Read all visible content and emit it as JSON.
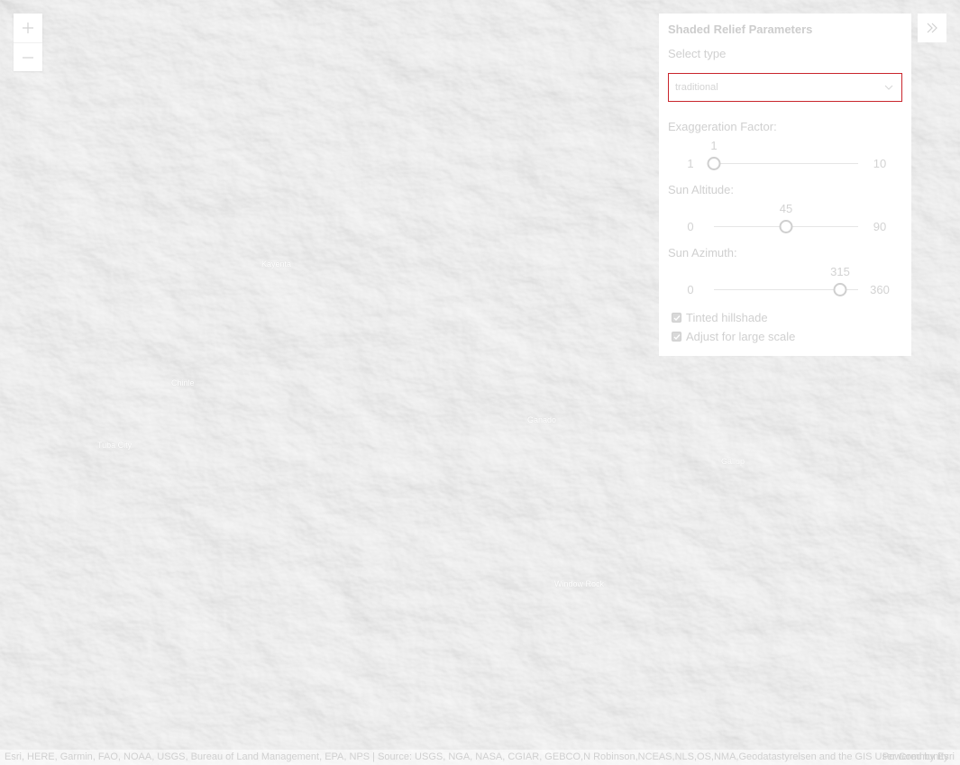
{
  "map": {
    "background_color": "#ececec",
    "labels": [
      {
        "id": "place-1",
        "text": "Kayenta"
      },
      {
        "id": "place-2",
        "text": "Chinle"
      },
      {
        "id": "place-3",
        "text": "Tuba City"
      },
      {
        "id": "place-4",
        "text": "Ganado"
      },
      {
        "id": "place-5",
        "text": "Gallup"
      },
      {
        "id": "place-6",
        "text": "Window Rock"
      }
    ]
  },
  "zoom": {
    "in_icon": "plus-icon",
    "out_icon": "minus-icon"
  },
  "collapse": {
    "icon": "double-chevron-right-icon"
  },
  "panel": {
    "title": "Shaded Relief Parameters",
    "select_type_label": "Select type",
    "select_value": "traditional",
    "select_border_color": "#c9252c",
    "exaggeration": {
      "label": "Exaggeration Factor:",
      "value": "1",
      "min": "1",
      "max": "10",
      "fraction": 0.0
    },
    "altitude": {
      "label": "Sun Altitude:",
      "value": "45",
      "min": "0",
      "max": "90",
      "fraction": 0.5
    },
    "azimuth": {
      "label": "Sun Azimuth:",
      "value": "315",
      "min": "0",
      "max": "360",
      "fraction": 0.875
    },
    "tinted_label": "Tinted hillshade",
    "tinted_checked": true,
    "adjust_label": "Adjust for large scale",
    "adjust_checked": true
  },
  "attribution": {
    "text": "Esri, HERE, Garmin, FAO, NOAA, USGS, Bureau of Land Management, EPA, NPS | Source: USGS, NGA, NASA, CGIAR, GEBCO,N Robinson,NCEAS,NLS,OS,NMA,Geodatastyrelsen and the GIS User Community",
    "powered_by": "Powered by Esri"
  }
}
